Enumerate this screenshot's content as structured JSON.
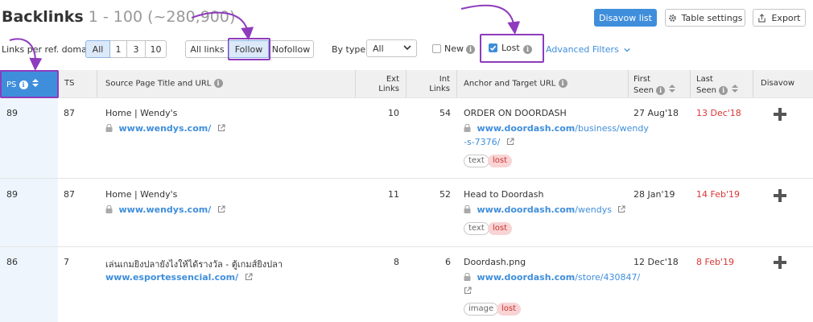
{
  "header": {
    "title": "Backlinks",
    "count": "1 - 100 (~280,900)",
    "disavow_label": "Disavow list",
    "table_settings_label": "Table settings",
    "export_label": "Export"
  },
  "filters": {
    "per_domain_label": "Links per ref. domain",
    "per_domain_options": [
      "All",
      "1",
      "3",
      "10"
    ],
    "per_domain_selected": "All",
    "follow_options": [
      "All links",
      "Follow",
      "Nofollow"
    ],
    "follow_selected": "Follow",
    "by_type_label": "By type",
    "by_type_value": "All",
    "new_label": "New",
    "new_checked": false,
    "lost_label": "Lost",
    "lost_checked": true,
    "advanced_label": "Advanced Filters"
  },
  "columns": {
    "ps": "PS",
    "ts": "TS",
    "source": "Source Page Title and URL",
    "ext_links_1": "Ext",
    "ext_links_2": "Links",
    "int_links_1": "Int",
    "int_links_2": "Links",
    "anchor": "Anchor and Target URL",
    "first_seen_1": "First",
    "first_seen_2": "Seen",
    "last_seen_1": "Last",
    "last_seen_2": "Seen",
    "disavow": "Disavow"
  },
  "rows": [
    {
      "ps": "89",
      "ts": "87",
      "source_title": "Home | Wendy's",
      "source_domain": "www.wendys.com/",
      "ext_links": "10",
      "int_links": "54",
      "anchor": "ORDER ON DOORDASH",
      "target_domain": "www.doordash.com",
      "target_path_1": "/business/wendy",
      "target_path_2": "-s-7376/",
      "tag_type": "text",
      "tag_status": "lost",
      "first_seen": "27 Aug'18",
      "last_seen": "13 Dec'18"
    },
    {
      "ps": "89",
      "ts": "87",
      "source_title": "Home | Wendy's",
      "source_domain": "www.wendys.com/",
      "ext_links": "11",
      "int_links": "52",
      "anchor": "Head to Doordash",
      "target_domain": "www.doordash.com",
      "target_path_1": "/wendys",
      "tag_type": "text",
      "tag_status": "lost",
      "first_seen": "28 Jan'19",
      "last_seen": "14 Feb'19"
    },
    {
      "ps": "86",
      "ts": "7",
      "source_title": "เล่นเกมยิงปลายังไงให้ได้รางวัล - ตู้เกมส์ยิงปลา",
      "source_domain": "www.esportessencial.com/",
      "ext_links": "8",
      "int_links": "6",
      "anchor": "Doordash.png",
      "target_domain": "www.doordash.com",
      "target_path_1": "/store/430847/",
      "tag_type": "image",
      "tag_status": "lost",
      "first_seen": "12 Dec'18",
      "last_seen": "8 Feb'19"
    }
  ],
  "colors": {
    "accent": "#3f8edb",
    "highlight": "#8e3bbd",
    "lost_red": "#d93636",
    "header_bg": "#f0f0f0"
  },
  "icons": [
    "gear-icon",
    "export-icon",
    "info-icon",
    "sort-icon",
    "lock-icon",
    "external-link-icon",
    "chevron-down-icon",
    "plus-icon",
    "annotation-arrow"
  ]
}
